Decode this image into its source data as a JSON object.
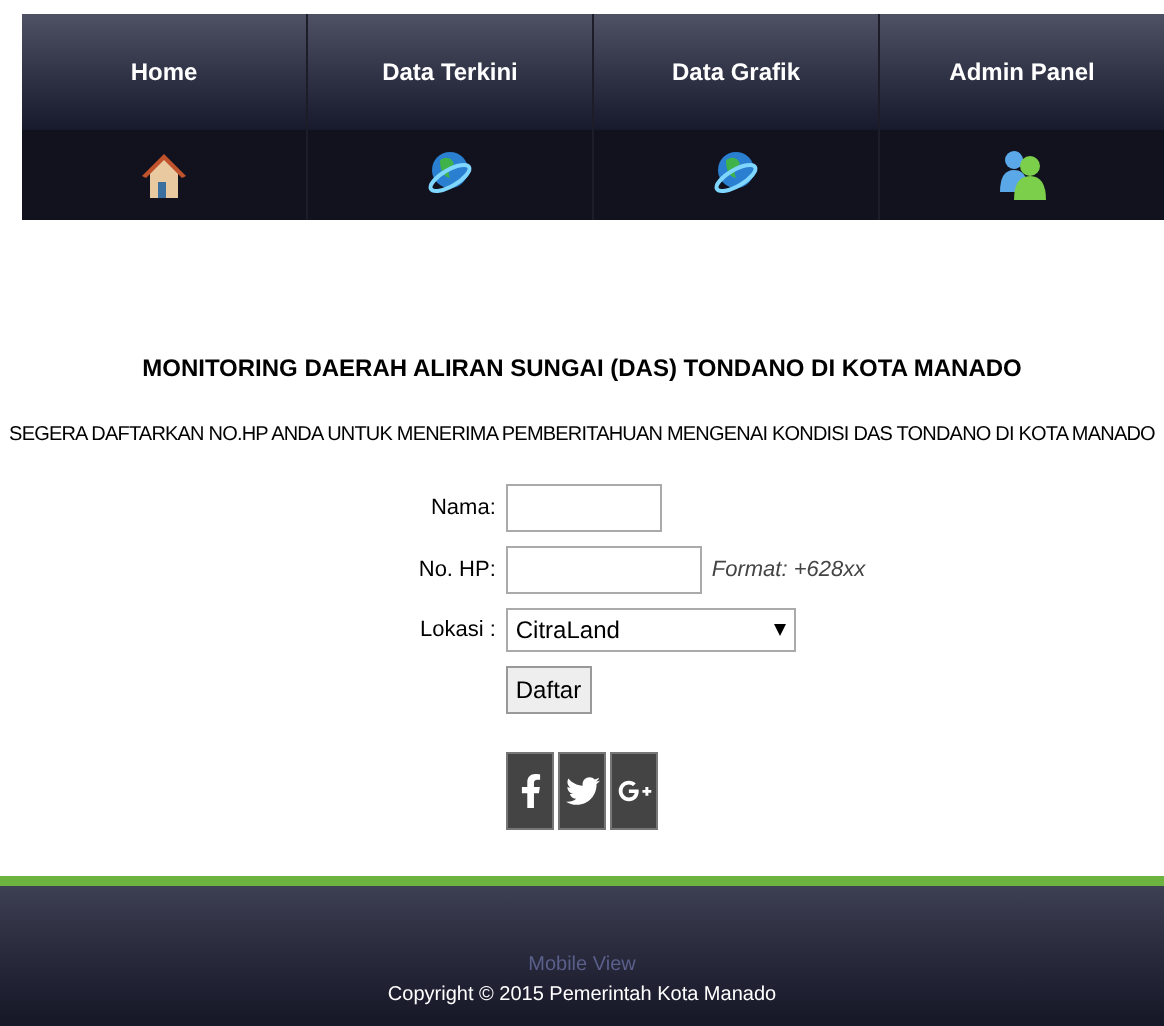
{
  "nav": [
    {
      "label": "Home",
      "kind": "house"
    },
    {
      "label": "Data Terkini",
      "kind": "globe"
    },
    {
      "label": "Data Grafik",
      "kind": "globe"
    },
    {
      "label": "Admin Panel",
      "kind": "users"
    }
  ],
  "title": "MONITORING DAERAH ALIRAN SUNGAI (DAS) TONDANO DI KOTA MANADO",
  "notice": "SEGERA DAFTARKAN NO.HP ANDA UNTUK MENERIMA PEMBERITAHUAN MENGENAI KONDISI DAS TONDANO DI KOTA MANADO",
  "form": {
    "name_label": "Nama:",
    "phone_label": "No. HP:",
    "phone_hint": "Format: +628xx",
    "location_label": "Lokasi :",
    "location_value": "CitraLand",
    "submit": "Daftar"
  },
  "social": [
    {
      "kind": "facebook"
    },
    {
      "kind": "twitter"
    },
    {
      "kind": "googleplus"
    }
  ],
  "footer": {
    "mobile_link": "Mobile View",
    "copyright": "Copyright © 2015 Pemerintah Kota Manado"
  }
}
